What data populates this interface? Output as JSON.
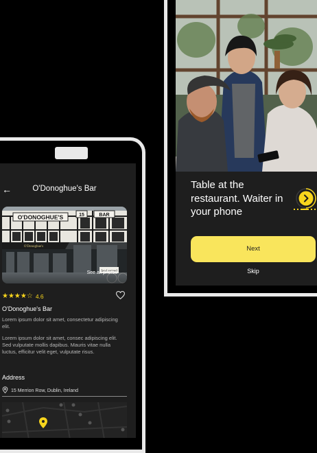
{
  "restaurant_screen": {
    "back_glyph": "←",
    "title": "O'Donoghue's Bar",
    "photo_link": "See all photos",
    "rating": 4.6,
    "rating_text": "4.6",
    "name": "O'Donoghue's Bar",
    "description_short": "Lorem ipsum dolor sit amet, consectetur adipiscing elit.",
    "description_long": "Lorem ipsum dolor sit amet, consec adipiscing elit. Sed vulputate mollis dapibus. Mauris vitae nulla luctus, efficitur velit eget, vulputate risus.",
    "address_heading": "Address",
    "address": "15 Merrion Row, Dublin, Ireland",
    "storefront_sign": "O'DONOGHUE'S",
    "icons": {
      "back": "back-arrow-icon",
      "heart": "heart-icon",
      "pin": "location-pin-icon",
      "stars": "star-icon"
    }
  },
  "onboarding_screen": {
    "title": "Table at the restaurant. Waiter in your phone",
    "next_label": "Next",
    "skip_label": "Skip",
    "progress_fraction": 0.5,
    "icons": {
      "next": "chevron-right-icon"
    }
  },
  "colors": {
    "accent": "#f7d51d",
    "button": "#f9e55c",
    "background": "#1e1e1e"
  }
}
